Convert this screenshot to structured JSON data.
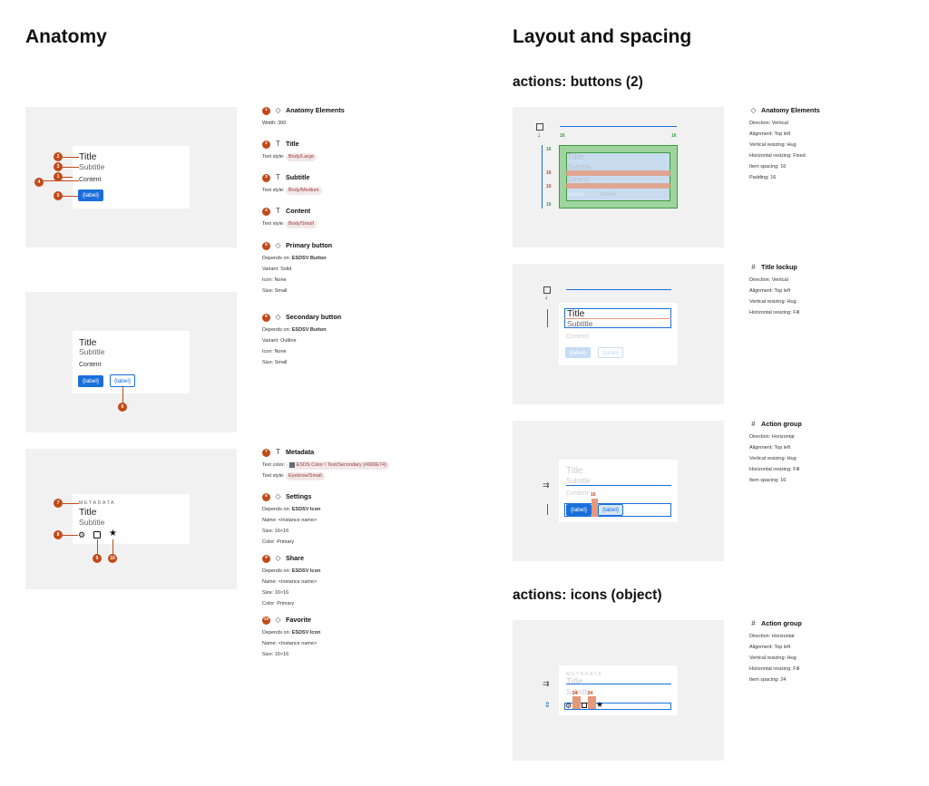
{
  "headings": {
    "anatomy": "Anatomy",
    "layout": "Layout and spacing",
    "buttons_section": "actions: buttons (2)",
    "icons_section": "actions: icons (object)"
  },
  "card": {
    "title": "Title",
    "subtitle": "Subtitle",
    "content": "Content",
    "button_label": "{label}",
    "metadata": "METADATA"
  },
  "badges": [
    "1",
    "2",
    "3",
    "4",
    "5",
    "6",
    "7",
    "8",
    "9",
    "10"
  ],
  "anatomy_specs": [
    {
      "num": "1",
      "icon": "◇",
      "name": "Anatomy Elements",
      "lines": [
        "Width: 300"
      ]
    },
    {
      "num": "2",
      "icon": "T",
      "name": "Title",
      "label": "Text style:",
      "tag": "Body/Large"
    },
    {
      "num": "3",
      "icon": "T",
      "name": "Subtitle",
      "label": "Text style:",
      "tag": "Body/Medium"
    },
    {
      "num": "4",
      "icon": "T",
      "name": "Content",
      "label": "Text style:",
      "tag": "Body/Small"
    },
    {
      "num": "5",
      "icon": "◇",
      "name": "Primary button",
      "depends_label": "Depends on:",
      "depends": "ESDSV Button",
      "lines": [
        "Variant: Solid",
        "Icon: None",
        "Size: Small"
      ]
    },
    {
      "num": "6",
      "icon": "◇",
      "name": "Secondary button",
      "depends_label": "Depends on:",
      "depends": "ESDSV Button",
      "lines": [
        "Variant: Outline",
        "Icon: None",
        "Size: Small"
      ]
    },
    {
      "num": "7",
      "icon": "T",
      "name": "Metadata",
      "color_label": "Text color:",
      "color_tag": "ESDS Color / Text/Secondary",
      "color_hex": "(#666E74)",
      "label": "Text style:",
      "tag": "Eyebrow/Small"
    },
    {
      "num": "8",
      "icon": "◇",
      "name": "Settings",
      "depends_label": "Depends on:",
      "depends": "ESDSV Icon",
      "lines": [
        "Name: <Instance name>",
        "Size: 16×16",
        "Color: Primary"
      ]
    },
    {
      "num": "9",
      "icon": "◇",
      "name": "Share",
      "depends_label": "Depends on:",
      "depends": "ESDSV Icon",
      "lines": [
        "Name: <Instance name>",
        "Size: 16×16",
        "Color: Primary"
      ]
    },
    {
      "num": "10",
      "icon": "◇",
      "name": "Favorite",
      "depends_label": "Depends on:",
      "depends": "ESDSV Icon",
      "lines": [
        "Name: <Instance name>",
        "Size: 16×16"
      ]
    }
  ],
  "layout_specs": [
    {
      "icon": "◇",
      "name": "Anatomy Elements",
      "lines": [
        "Direction: Vertical",
        "Alignment:  Top left",
        "Vertical resizing: Hug",
        "Horizontal resizing: Fixed",
        "Item spacing: 16",
        "Padding: 16"
      ]
    },
    {
      "icon": "#",
      "name": "Title lockup",
      "lines": [
        "Direction: Vertical",
        "Alignment:  Top left",
        "Vertical resizing: Hug",
        "Horizontal resizing: Fill"
      ]
    },
    {
      "icon": "#",
      "name": "Action group",
      "lines": [
        "Direction: Horizontal",
        "Alignment:  Top left",
        "Vertical resizing: Hug",
        "Horizontal resizing: Fill",
        "Item spacing: 16"
      ]
    },
    {
      "icon": "#",
      "name": "Action group",
      "lines": [
        "Direction: Horizontal",
        "Alignment:  Top left",
        "Vertical resizing: Hug",
        "Horizontal resizing: Fill",
        "Item spacing: 24"
      ]
    }
  ],
  "measures": {
    "padding": "16",
    "spacing16": "16",
    "spacing24": "24"
  },
  "colors": {
    "accent": "#1a6fdb",
    "badge": "#c24a18",
    "panel": "#f1f1f1",
    "padding_green": "#3c9a3c",
    "spacing_orange": "#e6987a"
  }
}
